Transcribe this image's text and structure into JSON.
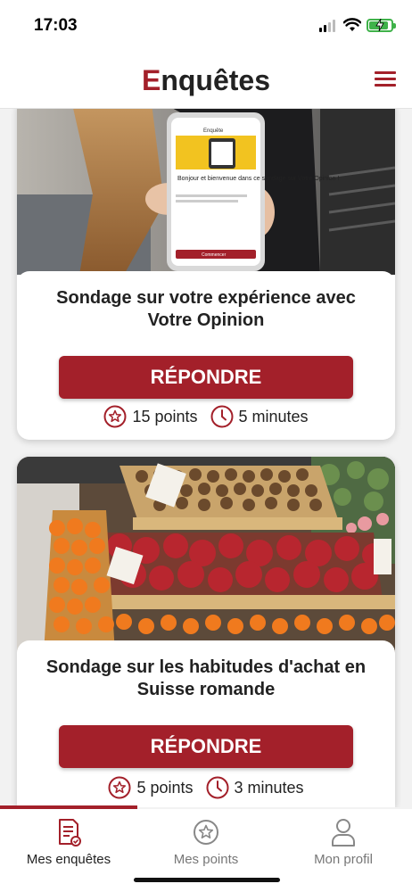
{
  "status": {
    "time": "17:03"
  },
  "header": {
    "title_first": "E",
    "title_rest": "nquêtes",
    "menu_icon": "hamburger-icon"
  },
  "colors": {
    "accent": "#a3202a",
    "battery": "#3fb24a"
  },
  "surveys": [
    {
      "title": "Sondage sur votre expérience avec Votre Opinion",
      "button": "RÉPONDRE",
      "points": "15 points",
      "duration": "5 minutes",
      "image": "person-holding-phone-photo",
      "phone_screen": {
        "app": "Enquête",
        "greeting": "Bonjour et bienvenue dans ce sondage sur Votre Opinion !",
        "button": "Commencer"
      }
    },
    {
      "title": "Sondage sur les habitudes d'achat en Suisse romande",
      "button": "RÉPONDRE",
      "points": "5 points",
      "duration": "3 minutes",
      "image": "fruit-market-stall-photo"
    }
  ],
  "nav": {
    "items": [
      {
        "label": "Mes enquêtes",
        "icon": "survey-document-icon",
        "active": true
      },
      {
        "label": "Mes points",
        "icon": "star-circle-icon",
        "active": false
      },
      {
        "label": "Mon profil",
        "icon": "person-icon",
        "active": false
      }
    ]
  }
}
